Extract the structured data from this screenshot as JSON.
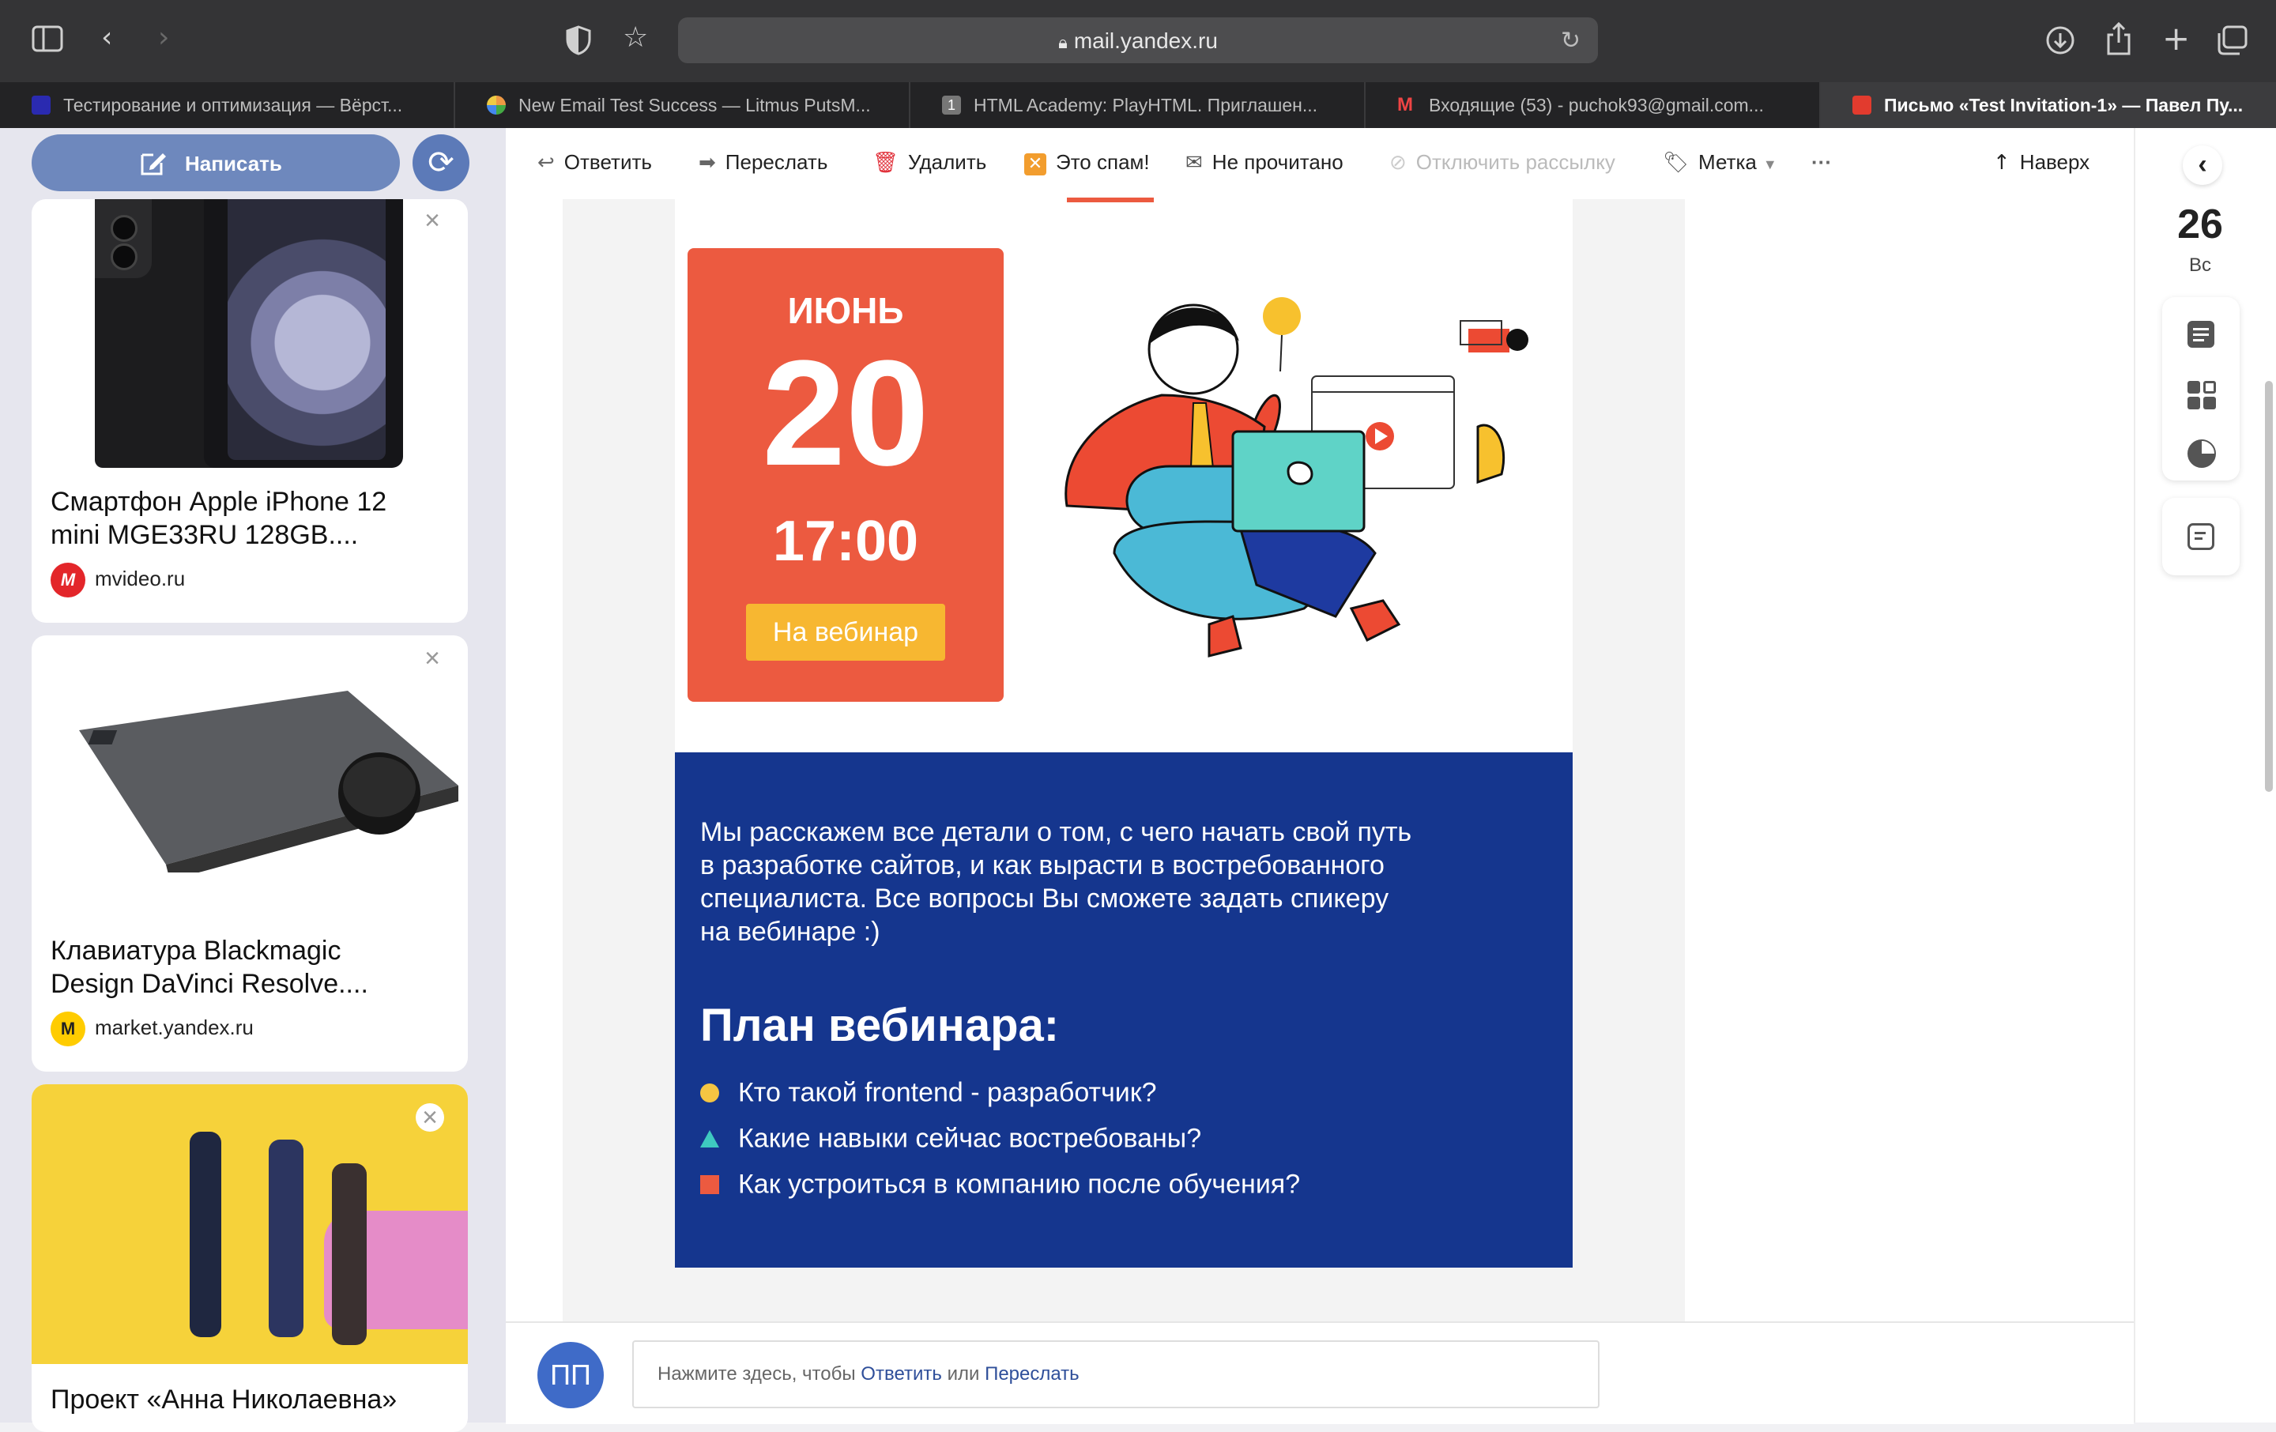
{
  "browser": {
    "url": "mail.yandex.ru",
    "tabs": [
      {
        "title": "Тестирование и оптимизация — Вёрст...",
        "favicon_color": "#2a2ab0",
        "active": false
      },
      {
        "title": "New Email Test Success — Litmus PutsM...",
        "favicon_color": "#8a8a3a",
        "active": false
      },
      {
        "title": "HTML Academy: PlayHTML. Приглашен...",
        "favicon_color": "#777777",
        "active": false
      },
      {
        "title": "Входящие (53) - puchok93@gmail.com...",
        "favicon_color": "#d93025",
        "active": false
      },
      {
        "title": "Письмо «Test Invitation-1» — Павел Пу...",
        "favicon_color": "#e23b2e",
        "active": true
      }
    ]
  },
  "sidebar": {
    "compose_label": "Написать",
    "ads": [
      {
        "title_line1": "Смартфон Apple iPhone 12",
        "title_line2": "mini MGE33RU 128GB....",
        "source": "mvideo.ru",
        "logo_color": "#e3262a"
      },
      {
        "title_line1": "Клавиатура Blackmagic",
        "title_line2": "Design DaVinci Resolve....",
        "source": "market.yandex.ru",
        "logo_color": "#ffcc00"
      },
      {
        "title_line1": "Проект «Анна Николаевна»",
        "title_line2": "",
        "source": "",
        "logo_color": "#f4d43a"
      }
    ]
  },
  "toolbar": {
    "reply": "Ответить",
    "forward": "Переслать",
    "delete": "Удалить",
    "spam": "Это спам!",
    "unread": "Не прочитано",
    "unsubscribe": "Отключить рассылку",
    "label": "Метка",
    "more": "···",
    "top": "Наверх"
  },
  "email": {
    "date": {
      "month": "ИЮНЬ",
      "day": "20",
      "time": "17:00",
      "button": "На вебинар"
    },
    "description": [
      "Мы расскажем все детали о том, с чего начать свой путь",
      "в разработке сайтов, и как вырасти в востребованного",
      "специалиста. Все вопросы Вы сможете задать спикеру",
      "на вебинаре :)"
    ],
    "plan_title": "План вебинара:",
    "plan_items": [
      {
        "text": "Кто такой frontend - разработчик?",
        "marker": "circle",
        "color": "#f5c542"
      },
      {
        "text": "Какие навыки сейчас востребованы?",
        "marker": "triangle",
        "color": "#3ec9c0"
      },
      {
        "text": "Как устроиться в компанию после обучения?",
        "marker": "square",
        "color": "#ec5a40"
      }
    ],
    "colors": {
      "accent_red": "#ec5a40",
      "accent_yellow": "#f7b731",
      "plan_bg": "#15368e"
    }
  },
  "reply_bar": {
    "avatar_initials": "ПП",
    "text_prefix": "Нажмите здесь, чтобы",
    "reply_link": "Ответить",
    "or": "или",
    "forward_link": "Переслать"
  },
  "calendar": {
    "day": "26",
    "weekday": "Вс"
  }
}
